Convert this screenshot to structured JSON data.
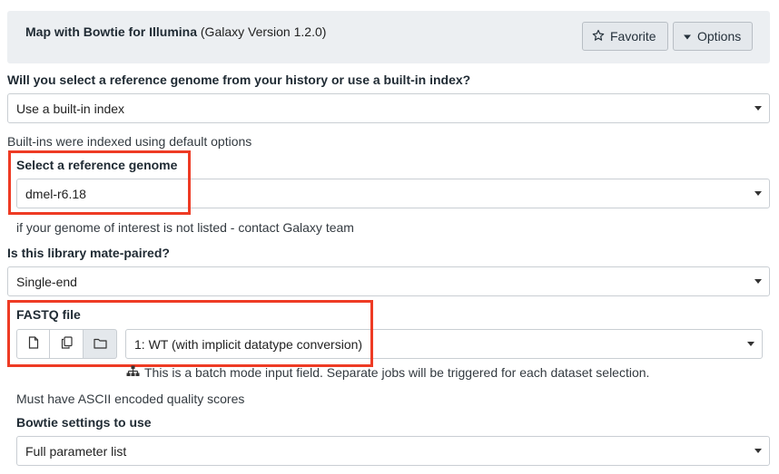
{
  "header": {
    "tool_name": "Map with Bowtie for Illumina",
    "tool_version": "(Galaxy Version 1.2.0)",
    "favorite_label": "Favorite",
    "options_label": "Options"
  },
  "reference_source": {
    "label": "Will you select a reference genome from your history or use a built-in index?",
    "value": "Use a built-in index",
    "help": "Built-ins were indexed using default options"
  },
  "reference_genome": {
    "label": "Select a reference genome",
    "value": "dmel-r6.18",
    "help": "if your genome of interest is not listed - contact Galaxy team"
  },
  "library_type": {
    "label": "Is this library mate-paired?",
    "value": "Single-end"
  },
  "fastq": {
    "label": "FASTQ file",
    "value": "1: WT (with implicit datatype conversion)",
    "batch_note": "This is a batch mode input field. Separate jobs will be triggered for each dataset selection.",
    "help": "Must have ASCII encoded quality scores",
    "modes": [
      "single-dataset",
      "multiple-datasets",
      "dataset-collection"
    ]
  },
  "bowtie_settings": {
    "label": "Bowtie settings to use",
    "value": "Full parameter list"
  },
  "colors": {
    "highlight": "#ee3b24",
    "header_bg": "#eceff2"
  }
}
